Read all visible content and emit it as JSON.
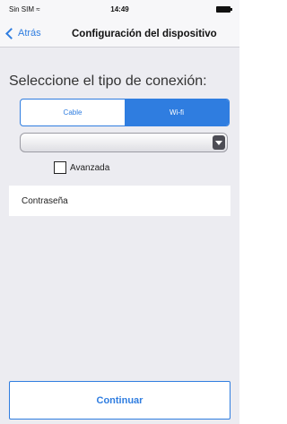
{
  "status_bar": {
    "carrier": "Sin SIM",
    "wifi_icon": "wifi-icon",
    "time": "14:49",
    "battery_icon": "battery-icon"
  },
  "nav": {
    "back_label": "Atrás",
    "title": "Configuración del dispositivo"
  },
  "main": {
    "prompt": "Seleccione el tipo de conexión:",
    "segments": [
      {
        "label": "Cable",
        "selected": false
      },
      {
        "label": "Wi-fi",
        "selected": true
      }
    ],
    "network_select": {
      "value": ""
    },
    "advanced_label": "Avanzada",
    "advanced_checked": false,
    "password_placeholder": "Contraseña",
    "continue_label": "Continuar"
  },
  "colors": {
    "accent": "#2f7de0",
    "background": "#ececf1",
    "bar": "#f7f7f9"
  }
}
